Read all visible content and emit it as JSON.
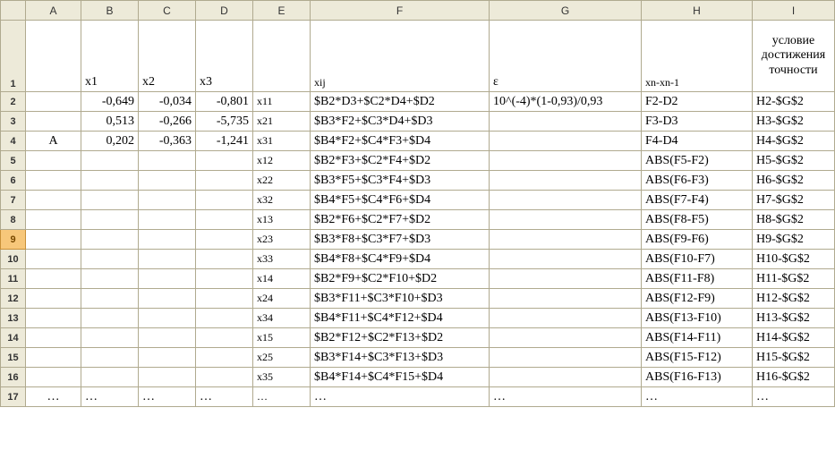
{
  "columns": [
    "A",
    "B",
    "C",
    "D",
    "E",
    "F",
    "G",
    "H",
    "I"
  ],
  "rowNumbers": [
    "1",
    "2",
    "3",
    "4",
    "5",
    "6",
    "7",
    "8",
    "9",
    "10",
    "11",
    "12",
    "13",
    "14",
    "15",
    "16",
    "17"
  ],
  "row1": {
    "B": "x1",
    "C": "x2",
    "D": "x3",
    "F": "xij",
    "G": "ε",
    "H": "xn-xn-1",
    "I": "условие достижения точности"
  },
  "rows": [
    {
      "A": "",
      "B": "-0,649",
      "C": "-0,034",
      "D": "-0,801",
      "E": "x11",
      "F": "$B2*D3+$C2*D4+$D2",
      "G": "10^(-4)*(1-0,93)/0,93",
      "H": "F2-D2",
      "I": "H2-$G$2"
    },
    {
      "A": "",
      "B": "0,513",
      "C": "-0,266",
      "D": "-5,735",
      "E": "x21",
      "F": "$B3*F2+$C3*D4+$D3",
      "G": "",
      "H": "F3-D3",
      "I": "H3-$G$2"
    },
    {
      "A": "A",
      "B": "0,202",
      "C": "-0,363",
      "D": "-1,241",
      "E": "x31",
      "F": "$B4*F2+$C4*F3+$D4",
      "G": "",
      "H": "F4-D4",
      "I": "H4-$G$2"
    },
    {
      "A": "",
      "B": "",
      "C": "",
      "D": "",
      "E": "x12",
      "F": "$B2*F3+$C2*F4+$D2",
      "G": "",
      "H": "ABS(F5-F2)",
      "I": "H5-$G$2"
    },
    {
      "A": "",
      "B": "",
      "C": "",
      "D": "",
      "E": "x22",
      "F": "$B3*F5+$C3*F4+$D3",
      "G": "",
      "H": "ABS(F6-F3)",
      "I": "H6-$G$2"
    },
    {
      "A": "",
      "B": "",
      "C": "",
      "D": "",
      "E": "x32",
      "F": "$B4*F5+$C4*F6+$D4",
      "G": "",
      "H": "ABS(F7-F4)",
      "I": "H7-$G$2"
    },
    {
      "A": "",
      "B": "",
      "C": "",
      "D": "",
      "E": "x13",
      "F": "$B2*F6+$C2*F7+$D2",
      "G": "",
      "H": "ABS(F8-F5)",
      "I": "H8-$G$2"
    },
    {
      "A": "",
      "B": "",
      "C": "",
      "D": "",
      "E": "x23",
      "F": "$B3*F8+$C3*F7+$D3",
      "G": "",
      "H": "ABS(F9-F6)",
      "I": "H9-$G$2"
    },
    {
      "A": "",
      "B": "",
      "C": "",
      "D": "",
      "E": "x33",
      "F": "$B4*F8+$C4*F9+$D4",
      "G": "",
      "H": "ABS(F10-F7)",
      "I": "H10-$G$2"
    },
    {
      "A": "",
      "B": "",
      "C": "",
      "D": "",
      "E": "x14",
      "F": "$B2*F9+$C2*F10+$D2",
      "G": "",
      "H": "ABS(F11-F8)",
      "I": "H11-$G$2"
    },
    {
      "A": "",
      "B": "",
      "C": "",
      "D": "",
      "E": "x24",
      "F": "$B3*F11+$C3*F10+$D3",
      "G": "",
      "H": "ABS(F12-F9)",
      "I": "H12-$G$2"
    },
    {
      "A": "",
      "B": "",
      "C": "",
      "D": "",
      "E": "x34",
      "F": "$B4*F11+$C4*F12+$D4",
      "G": "",
      "H": "ABS(F13-F10)",
      "I": "H13-$G$2"
    },
    {
      "A": "",
      "B": "",
      "C": "",
      "D": "",
      "E": "x15",
      "F": "$B2*F12+$C2*F13+$D2",
      "G": "",
      "H": "ABS(F14-F11)",
      "I": "H14-$G$2"
    },
    {
      "A": "",
      "B": "",
      "C": "",
      "D": "",
      "E": "x25",
      "F": "$B3*F14+$C3*F13+$D3",
      "G": "",
      "H": "ABS(F15-F12)",
      "I": "H15-$G$2"
    },
    {
      "A": "",
      "B": "",
      "C": "",
      "D": "",
      "E": "x35",
      "F": "$B4*F14+$C4*F15+$D4",
      "G": "",
      "H": "ABS(F16-F13)",
      "I": "H16-$G$2"
    },
    {
      "A": "…",
      "B": "…",
      "C": "…",
      "D": "…",
      "E": "…",
      "F": "…",
      "G": "…",
      "H": "…",
      "I": "…"
    }
  ],
  "selectedRow": 9
}
